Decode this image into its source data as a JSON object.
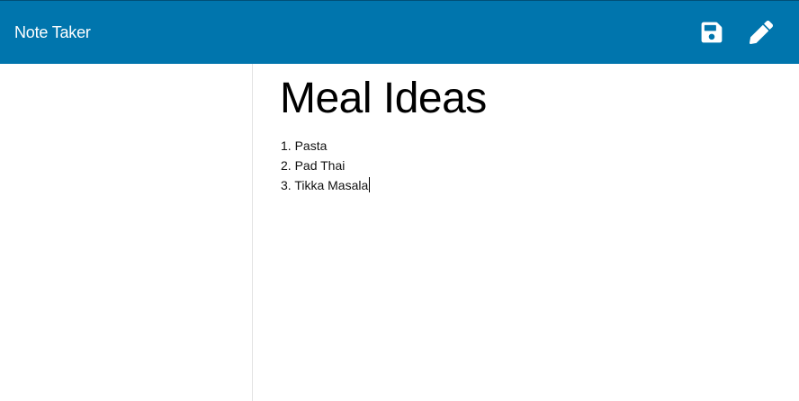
{
  "navbar": {
    "brand": "Note Taker",
    "background_color": "#0075ad",
    "save_icon": "floppy-disk-icon",
    "edit_icon": "pencil-icon"
  },
  "sidebar": {
    "notes": []
  },
  "editor": {
    "title": "Meal Ideas",
    "lines": [
      "1. Pasta",
      "2. Pad Thai",
      "3. Tikka Masala"
    ]
  }
}
